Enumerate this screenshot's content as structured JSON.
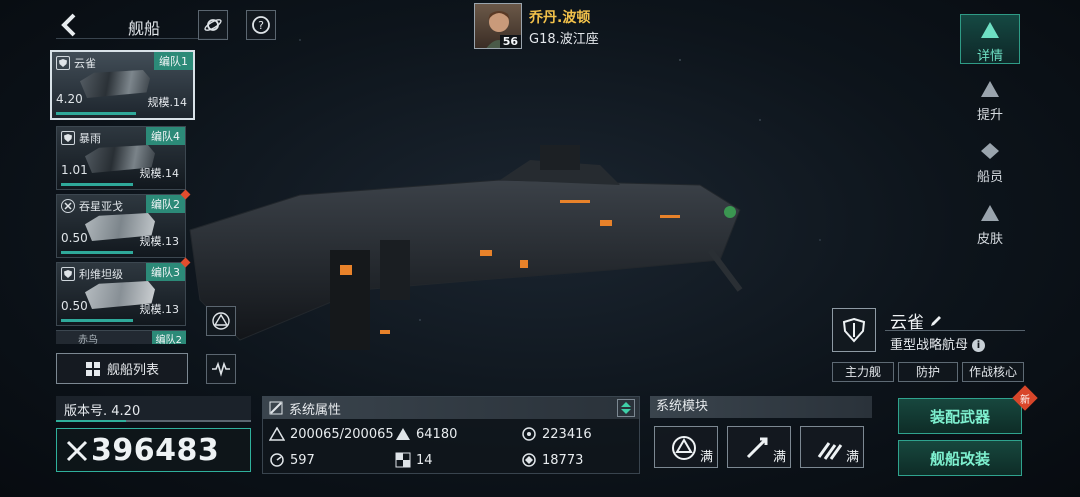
{
  "header": {
    "title": "舰船",
    "player_name": "乔丹.波顿",
    "player_level": "56",
    "player_location": "G18.波江座"
  },
  "ship_cards": [
    {
      "name": "云雀",
      "fleet": "编队1",
      "version": "4.20",
      "scale": "规模.14",
      "active": true
    },
    {
      "name": "暴雨",
      "fleet": "编队4",
      "version": "1.01",
      "scale": "规模.14"
    },
    {
      "name": "吞星亚戈",
      "fleet": "编队2",
      "version": "0.50",
      "scale": "规模.13"
    },
    {
      "name": "利维坦级",
      "fleet": "编队3",
      "version": "0.50",
      "scale": "规模.13"
    },
    {
      "name": "赤鸟",
      "fleet": "编队2"
    }
  ],
  "ship_list_button": "舰船列表",
  "right_nav": [
    {
      "label": "详情",
      "active": true
    },
    {
      "label": "提升"
    },
    {
      "label": "船员"
    },
    {
      "label": "皮肤"
    }
  ],
  "ship_info": {
    "name": "云雀",
    "type": "重型战略航母",
    "tags": [
      "主力舰",
      "防护",
      "作战核心"
    ]
  },
  "version_label": "版本号. 4.20",
  "power": "396483",
  "attributes": {
    "title": "系统属性",
    "values": [
      "200065/200065",
      "64180",
      "223416",
      "597",
      "14",
      "18773"
    ]
  },
  "modules": {
    "title": "系统模块",
    "full_label": "满"
  },
  "actions": {
    "equip": "装配武器",
    "modify": "舰船改装",
    "new_badge": "新"
  },
  "colors": {
    "accent": "#2fb09c",
    "fleet_tag": "#2c8a78",
    "player_name": "#f2c14a",
    "alert": "#e24d2e"
  }
}
